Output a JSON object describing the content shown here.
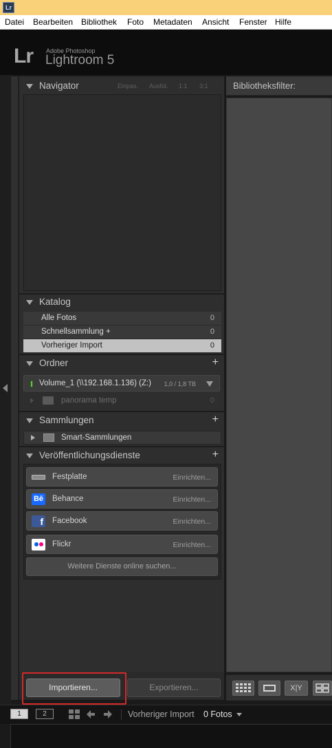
{
  "app": {
    "badge": "Lr"
  },
  "menu": [
    "Datei",
    "Bearbeiten",
    "Bibliothek",
    "Foto",
    "Metadaten",
    "Ansicht",
    "Fenster",
    "Hilfe"
  ],
  "identity": {
    "logo": "Lr",
    "company": "Adobe Photoshop",
    "product": "Lightroom 5"
  },
  "navigator": {
    "title": "Navigator",
    "zoom": [
      "Einpas.",
      "Ausfül.",
      "1:1",
      "3:1"
    ]
  },
  "catalog": {
    "title": "Katalog",
    "items": [
      {
        "label": "Alle Fotos",
        "count": "0"
      },
      {
        "label": "Schnellsammlung +",
        "count": "0"
      },
      {
        "label": "Vorheriger Import",
        "count": "0",
        "selected": true
      }
    ]
  },
  "folders": {
    "title": "Ordner",
    "add_icon": "+",
    "volume": {
      "name": "Volume_1 (\\\\192.168.1.136) (Z:)",
      "size": "1,0 / 1,8 TB"
    },
    "folder": {
      "name": "panorama temp",
      "count": "0"
    }
  },
  "collections": {
    "title": "Sammlungen",
    "add_icon": "+",
    "smart": "Smart-Sammlungen"
  },
  "publish": {
    "title": "Veröffentlichungsdienste",
    "add_icon": "+",
    "services": [
      {
        "name": "Festplatte",
        "setup": "Einrichten...",
        "icon": "hard-drive-icon"
      },
      {
        "name": "Behance",
        "setup": "Einrichten...",
        "icon": "behance-icon",
        "icon_text": "Bē"
      },
      {
        "name": "Facebook",
        "setup": "Einrichten...",
        "icon": "facebook-icon",
        "icon_text": "f"
      },
      {
        "name": "Flickr",
        "setup": "Einrichten...",
        "icon": "flickr-icon"
      }
    ],
    "more": "Weitere Dienste online suchen..."
  },
  "buttons": {
    "import": "Importieren...",
    "export": "Exportieren..."
  },
  "library_filter": {
    "label": "Bibliotheksfilter:"
  },
  "toolbar": {
    "xy": "X|Y"
  },
  "filmstrip": {
    "monitor1": "1",
    "monitor2": "2",
    "source": "Vorheriger Import",
    "count": "0 Fotos"
  },
  "colors": {
    "title_bar": "#f8d178",
    "highlight": "#d42a2a",
    "behance": "#1769ff",
    "facebook": "#3b5998",
    "flickr_blue": "#0063dc",
    "flickr_pink": "#ff0084"
  }
}
